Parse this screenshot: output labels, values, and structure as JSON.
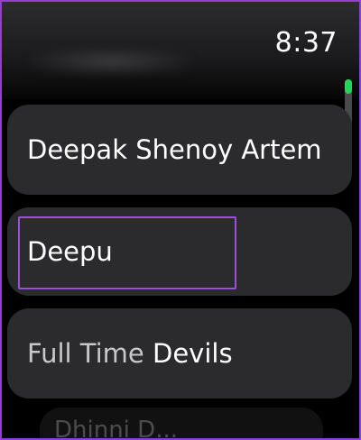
{
  "status_bar": {
    "time": "8:37"
  },
  "contacts": [
    {
      "label": "Deepak Shenoy Artem"
    },
    {
      "label": "Deepu"
    },
    {
      "first": "Full Time",
      "last": "Devils"
    },
    {
      "label": "Dhinni D..."
    }
  ],
  "colors": {
    "accent_highlight": "#9b4fe0",
    "scroll_thumb": "#2ed158",
    "card_bg": "#2b2b2d"
  }
}
